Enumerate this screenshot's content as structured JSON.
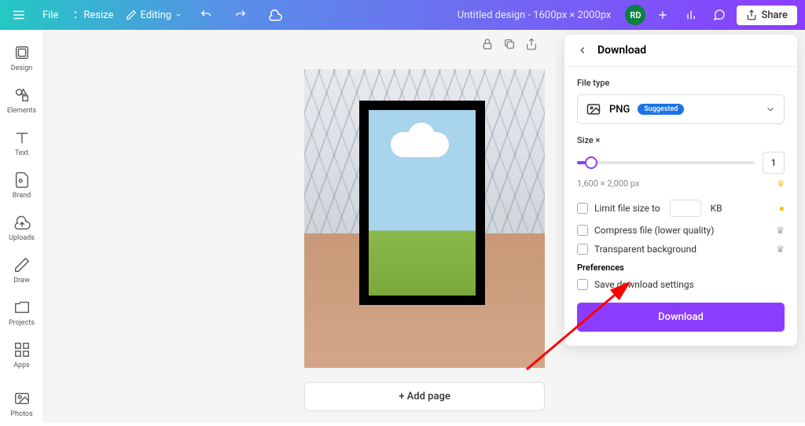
{
  "topbar": {
    "file": "File",
    "resize": "Resize",
    "editing": "Editing",
    "title": "Untitled design - 1600px × 2000px",
    "avatar": "RD",
    "share": "Share"
  },
  "sidebar": {
    "items": [
      {
        "label": "Design"
      },
      {
        "label": "Elements"
      },
      {
        "label": "Text"
      },
      {
        "label": "Brand"
      },
      {
        "label": "Uploads"
      },
      {
        "label": "Draw"
      },
      {
        "label": "Projects"
      },
      {
        "label": "Apps"
      },
      {
        "label": "Photos"
      }
    ]
  },
  "canvas": {
    "add_page": "+ Add page"
  },
  "panel": {
    "title": "Download",
    "file_type_label": "File type",
    "file_type": "PNG",
    "badge": "Suggested",
    "size_label": "Size ×",
    "size_value": "1",
    "dimensions": "1,600 × 2,000 px",
    "limit_label": "Limit file size to",
    "kb": "KB",
    "compress_label": "Compress file (lower quality)",
    "transparent_label": "Transparent background",
    "prefs_label": "Preferences",
    "save_settings_label": "Save download settings",
    "download_btn": "Download"
  }
}
